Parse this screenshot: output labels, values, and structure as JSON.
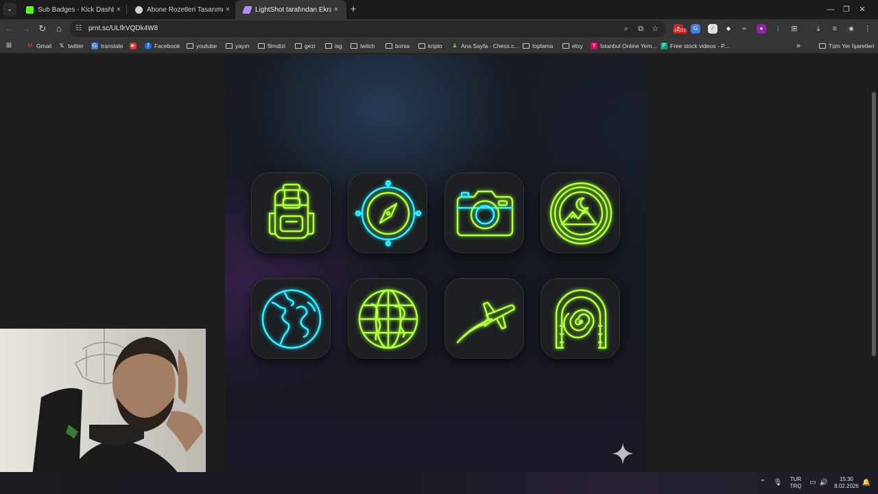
{
  "tabs": [
    {
      "title": "Sub Badges - Kick Dashboard",
      "favicon_color": "#53fc18",
      "active": false
    },
    {
      "title": "Abone Rozetleri Tasarımı",
      "favicon_color": "#d0d0d0",
      "active": false
    },
    {
      "title": "LightShot tarafından Ekran Gör",
      "favicon_color": "#b38bff",
      "active": true
    }
  ],
  "tab_close_glyph": "×",
  "new_tab_glyph": "+",
  "address_bar": {
    "url": "prnt.sc/ULflrVQDk4W8"
  },
  "extension_badge": "24221",
  "bookmarks": [
    {
      "label": "Gmail",
      "icon": "gmail-icon",
      "type": "link"
    },
    {
      "label": "twitter",
      "icon": "x-icon",
      "type": "link"
    },
    {
      "label": "translate",
      "icon": "translate-icon",
      "type": "link"
    },
    {
      "label": "",
      "icon": "youtube-icon",
      "type": "link"
    },
    {
      "label": "Facebook",
      "icon": "facebook-icon",
      "type": "link"
    },
    {
      "label": "youtube",
      "icon": "folder-icon",
      "type": "folder"
    },
    {
      "label": "yayın",
      "icon": "folder-icon",
      "type": "folder"
    },
    {
      "label": "filmdizi",
      "icon": "folder-icon",
      "type": "folder"
    },
    {
      "label": "gezi",
      "icon": "folder-icon",
      "type": "folder"
    },
    {
      "label": "isg",
      "icon": "folder-icon",
      "type": "folder"
    },
    {
      "label": "twitch",
      "icon": "folder-icon",
      "type": "folder"
    },
    {
      "label": "borsa",
      "icon": "folder-icon",
      "type": "folder"
    },
    {
      "label": "kripto",
      "icon": "folder-icon",
      "type": "folder"
    },
    {
      "label": "Ana Sayfa - Chess.c...",
      "icon": "chess-pawn-icon",
      "type": "link"
    },
    {
      "label": "toplama",
      "icon": "folder-icon",
      "type": "folder"
    },
    {
      "label": "etsy",
      "icon": "folder-icon",
      "type": "folder"
    },
    {
      "label": "İstanbul Online Yem...",
      "icon": "yemeksepeti-icon",
      "type": "link"
    },
    {
      "label": "Free stock videos - P...",
      "icon": "pexels-icon",
      "type": "link"
    }
  ],
  "bookmarks_overflow": "»",
  "all_bookmarks_label": "Tüm Yer İşaretleri",
  "badges": [
    {
      "name": "backpack",
      "color": "lime"
    },
    {
      "name": "compass",
      "color": "cyan-lime"
    },
    {
      "name": "camera",
      "color": "cyan-lime"
    },
    {
      "name": "moon-mountain",
      "color": "lime"
    },
    {
      "name": "globe",
      "color": "cyan"
    },
    {
      "name": "globe-grid",
      "color": "lime"
    },
    {
      "name": "airplane",
      "color": "lime"
    },
    {
      "name": "portal",
      "color": "lime"
    }
  ],
  "taskbar": {
    "language_top": "TUR",
    "language_bottom": "TRQ",
    "time": "15:30",
    "date": "8.02.2026"
  },
  "colors": {
    "neon_lime": "#b6ff4a",
    "neon_cyan": "#3ff0ff",
    "tile_bg": "#1d1f22"
  }
}
